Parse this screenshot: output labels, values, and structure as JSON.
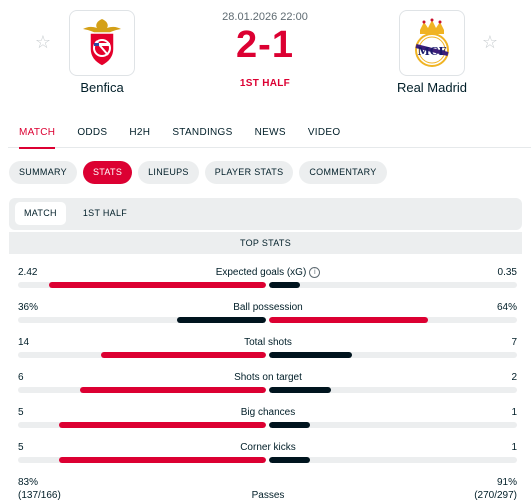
{
  "match": {
    "date": "28.01.2026 22:00",
    "score": "2-1",
    "status": "1ST HALF",
    "home": {
      "name": "Benfica"
    },
    "away": {
      "name": "Real Madrid"
    }
  },
  "main_tabs": [
    "MATCH",
    "ODDS",
    "H2H",
    "STANDINGS",
    "NEWS",
    "VIDEO"
  ],
  "sub_tabs": [
    "SUMMARY",
    "STATS",
    "LINEUPS",
    "PLAYER STATS",
    "COMMENTARY"
  ],
  "period_tabs": [
    "MATCH",
    "1ST HALF"
  ],
  "section_title": "TOP STATS",
  "stats": [
    {
      "label": "Expected goals (xG)",
      "home": "2.42",
      "away": "0.35",
      "home_share": 0.874,
      "away_share": 0.126,
      "info": "i"
    },
    {
      "label": "Ball possession",
      "home": "36%",
      "away": "64%",
      "home_share": 0.36,
      "away_share": 0.64
    },
    {
      "label": "Total shots",
      "home": "14",
      "away": "7",
      "home_share": 0.667,
      "away_share": 0.333
    },
    {
      "label": "Shots on target",
      "home": "6",
      "away": "2",
      "home_share": 0.75,
      "away_share": 0.25
    },
    {
      "label": "Big chances",
      "home": "5",
      "away": "1",
      "home_share": 0.833,
      "away_share": 0.167
    },
    {
      "label": "Corner kicks",
      "home": "5",
      "away": "1",
      "home_share": 0.833,
      "away_share": 0.167
    }
  ],
  "passes": {
    "label": "Passes",
    "home": "83%",
    "home_detail": "(137/166)",
    "away": "91%",
    "away_detail": "(270/297)"
  },
  "colors": {
    "accent": "#dc0032",
    "dark_bar": "#00141e",
    "track": "#eceeef"
  }
}
